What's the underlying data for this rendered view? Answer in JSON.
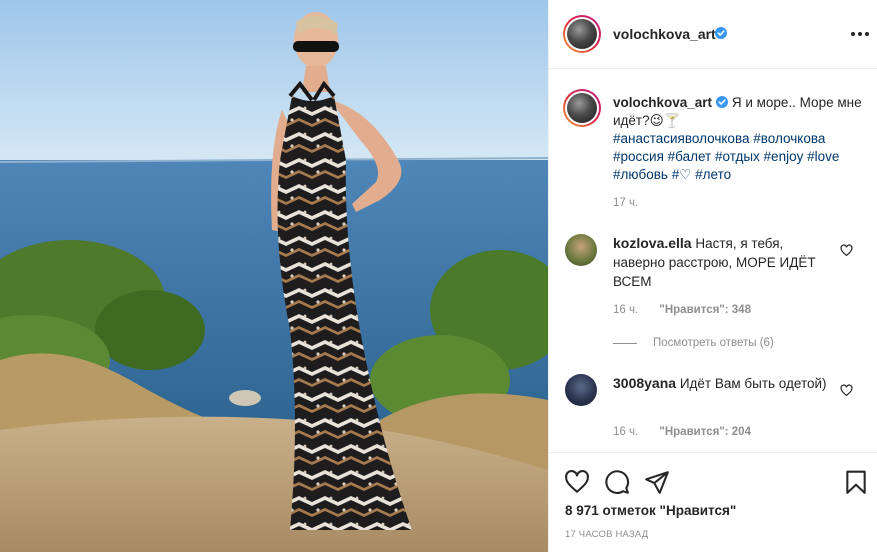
{
  "post": {
    "username": "volochkova_art",
    "caption": {
      "username": "volochkova_art",
      "text": "Я и море.. Море мне идёт?😉🍸",
      "hashtags": [
        "#анастасияволочкова",
        "#волочкова",
        "#россия",
        "#балет",
        "#отдых",
        "#enjoy",
        "#love",
        "#любовь",
        "#♡",
        "#лето"
      ],
      "time": "17 ч."
    },
    "comments": [
      {
        "username": "kozlova.ella",
        "text": "Настя, я тебя, наверно расстрою, МОРЕ ИДЁТ ВСЕМ",
        "time": "16 ч.",
        "likes_label": "\"Нравится\": 348",
        "replies_label": "Посмотреть ответы (6)"
      },
      {
        "username": "3008yana",
        "text": "Идёт Вам быть одетой)",
        "time": "16 ч.",
        "likes_label": "\"Нравится\": 204"
      }
    ],
    "likes_summary": "8 971 отметок \"Нравится\"",
    "posted_time": "17 ЧАСОВ НАЗАД"
  },
  "icons": {
    "more": "more-options-icon",
    "verified": "verified-badge-icon",
    "like": "heart-icon",
    "comment": "comment-icon",
    "share": "paper-plane-icon",
    "save": "bookmark-icon"
  },
  "colors": {
    "verified": "#3897f0",
    "hashtag": "#00376b",
    "muted": "#8e8e8e",
    "text": "#262626",
    "border": "#efefef"
  }
}
